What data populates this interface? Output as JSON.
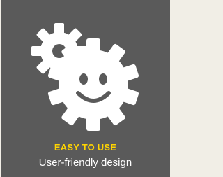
{
  "feature": {
    "title": "EASY TO USE",
    "subtitle": "User-friendly design",
    "icon": "smiling-gears-icon",
    "colors": {
      "background": "#5a5a5a",
      "page": "#f1eee6",
      "title": "#ffd400",
      "subtitle": "#ffffff",
      "icon": "#ffffff"
    }
  }
}
